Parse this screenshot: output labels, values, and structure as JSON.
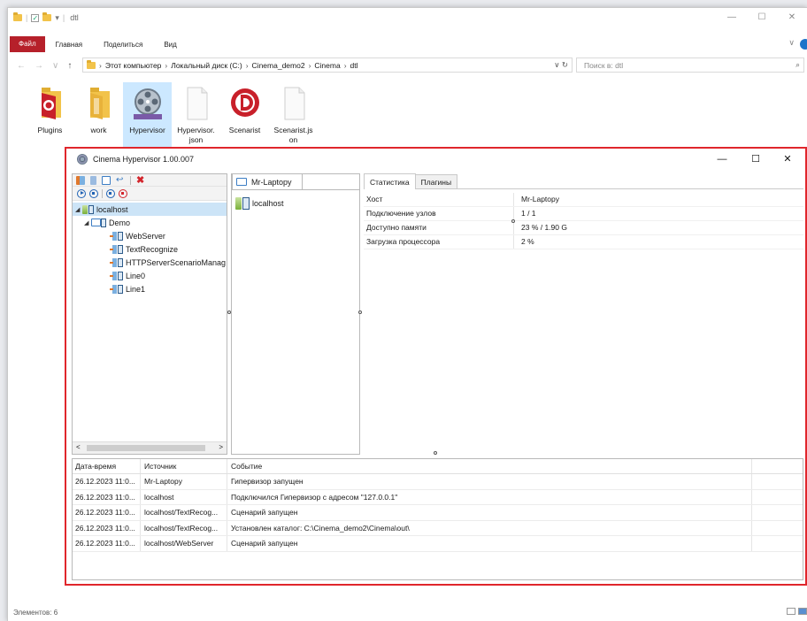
{
  "explorer": {
    "title": "dtl",
    "ribbon_tabs": [
      "Файл",
      "Главная",
      "Поделиться",
      "Вид"
    ],
    "breadcrumb": [
      "Этот компьютер",
      "Локальный диск (C:)",
      "Cinema_demo2",
      "Cinema",
      "dtl"
    ],
    "search_placeholder": "Поиск в: dtl",
    "files": [
      {
        "name": "Plugins",
        "icon": "red-d-folder-icon"
      },
      {
        "name": "work",
        "icon": "folder-icon"
      },
      {
        "name": "Hypervisor",
        "icon": "film-reel-icon",
        "selected": true
      },
      {
        "name": "Hypervisor.\njson",
        "icon": "blank-file-icon"
      },
      {
        "name": "Scenarist",
        "icon": "red-d-logo-icon"
      },
      {
        "name": "Scenarist.js\non",
        "icon": "blank-file-icon"
      }
    ],
    "status": "Элементов: 6"
  },
  "hypervisor": {
    "title": "Cinema Hypervisor 1.00.007",
    "tree": {
      "root": "localhost",
      "group": "Demo",
      "scenarios": [
        "WebServer",
        "TextRecognize",
        "HTTPServerScenarioManag",
        "Line0",
        "Line1"
      ]
    },
    "middle": {
      "tab": "Mr-Laptopy",
      "items": [
        "localhost"
      ]
    },
    "right": {
      "tabs": [
        "Статистика",
        "Плагины"
      ],
      "stats": [
        {
          "key": "Хост",
          "value": "Mr-Laptopy"
        },
        {
          "key": "Подключение узлов",
          "value": "1 / 1"
        },
        {
          "key": "Доступно памяти",
          "value": "23 % / 1.90 G"
        },
        {
          "key": "Загрузка процессора",
          "value": "2 %"
        }
      ]
    },
    "log": {
      "headers": [
        "Дата-время",
        "Источник",
        "Событие"
      ],
      "rows": [
        [
          "26.12.2023 11:0...",
          "Mr-Laptopy",
          "Гипервизор запущен"
        ],
        [
          "26.12.2023 11:0...",
          "localhost",
          "Подключился Гипервизор с адресом \"127.0.0.1\""
        ],
        [
          "26.12.2023 11:0...",
          "localhost/TextRecog...",
          "Сценарий запущен"
        ],
        [
          "26.12.2023 11:0...",
          "localhost/TextRecog...",
          "Установлен каталог: C:\\Cinema_demo2\\Cinema\\out\\"
        ],
        [
          "26.12.2023 11:0...",
          "localhost/WebServer",
          "Сценарий запущен"
        ]
      ]
    }
  },
  "colors": {
    "highlight_border": "#e0262c",
    "selection": "#cce8ff",
    "accent_blue": "#1f62b5",
    "file_tab": "#b6202a"
  }
}
